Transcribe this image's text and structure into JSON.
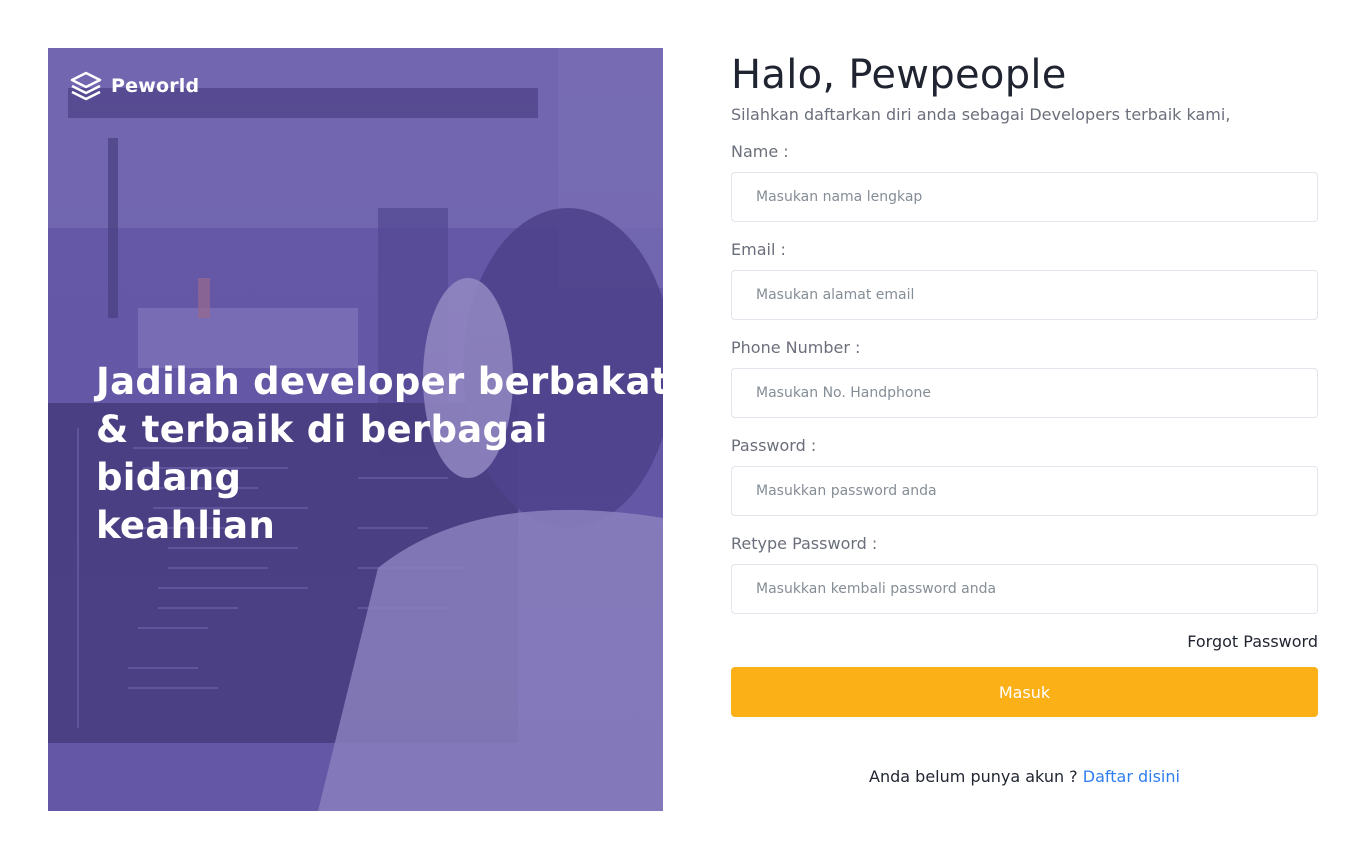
{
  "brand": {
    "name": "Peworld",
    "logo_icon": "layers-icon",
    "color": "#ffffff"
  },
  "hero": {
    "headline": "Jadilah developer berbakat\n& terbaik di berbagai bidang\nkeahlian",
    "overlay_color": "#5e50a1"
  },
  "form": {
    "greeting": "Halo, Pewpeople",
    "subtitle": "Silahkan daftarkan diri anda sebagai Developers terbaik kami,",
    "fields": [
      {
        "label": "Name :",
        "placeholder": "Masukan nama lengkap",
        "value": ""
      },
      {
        "label": "Email :",
        "placeholder": "Masukan alamat email",
        "value": ""
      },
      {
        "label": "Phone Number :",
        "placeholder": "Masukan No. Handphone",
        "value": ""
      },
      {
        "label": "Password :",
        "placeholder": "Masukkan password anda",
        "value": ""
      },
      {
        "label": "Retype Password :",
        "placeholder": "Masukkan kembali password anda",
        "value": ""
      }
    ],
    "forgot_label": "Forgot Password",
    "submit_label": "Masuk",
    "signup_prompt": "Anda belum punya akun ?",
    "signup_link": "Daftar disini"
  },
  "colors": {
    "accent": "#fbb017",
    "link": "#2f7ef0",
    "muted_text": "#6b6f7b",
    "input_border": "#e2e5ec"
  }
}
